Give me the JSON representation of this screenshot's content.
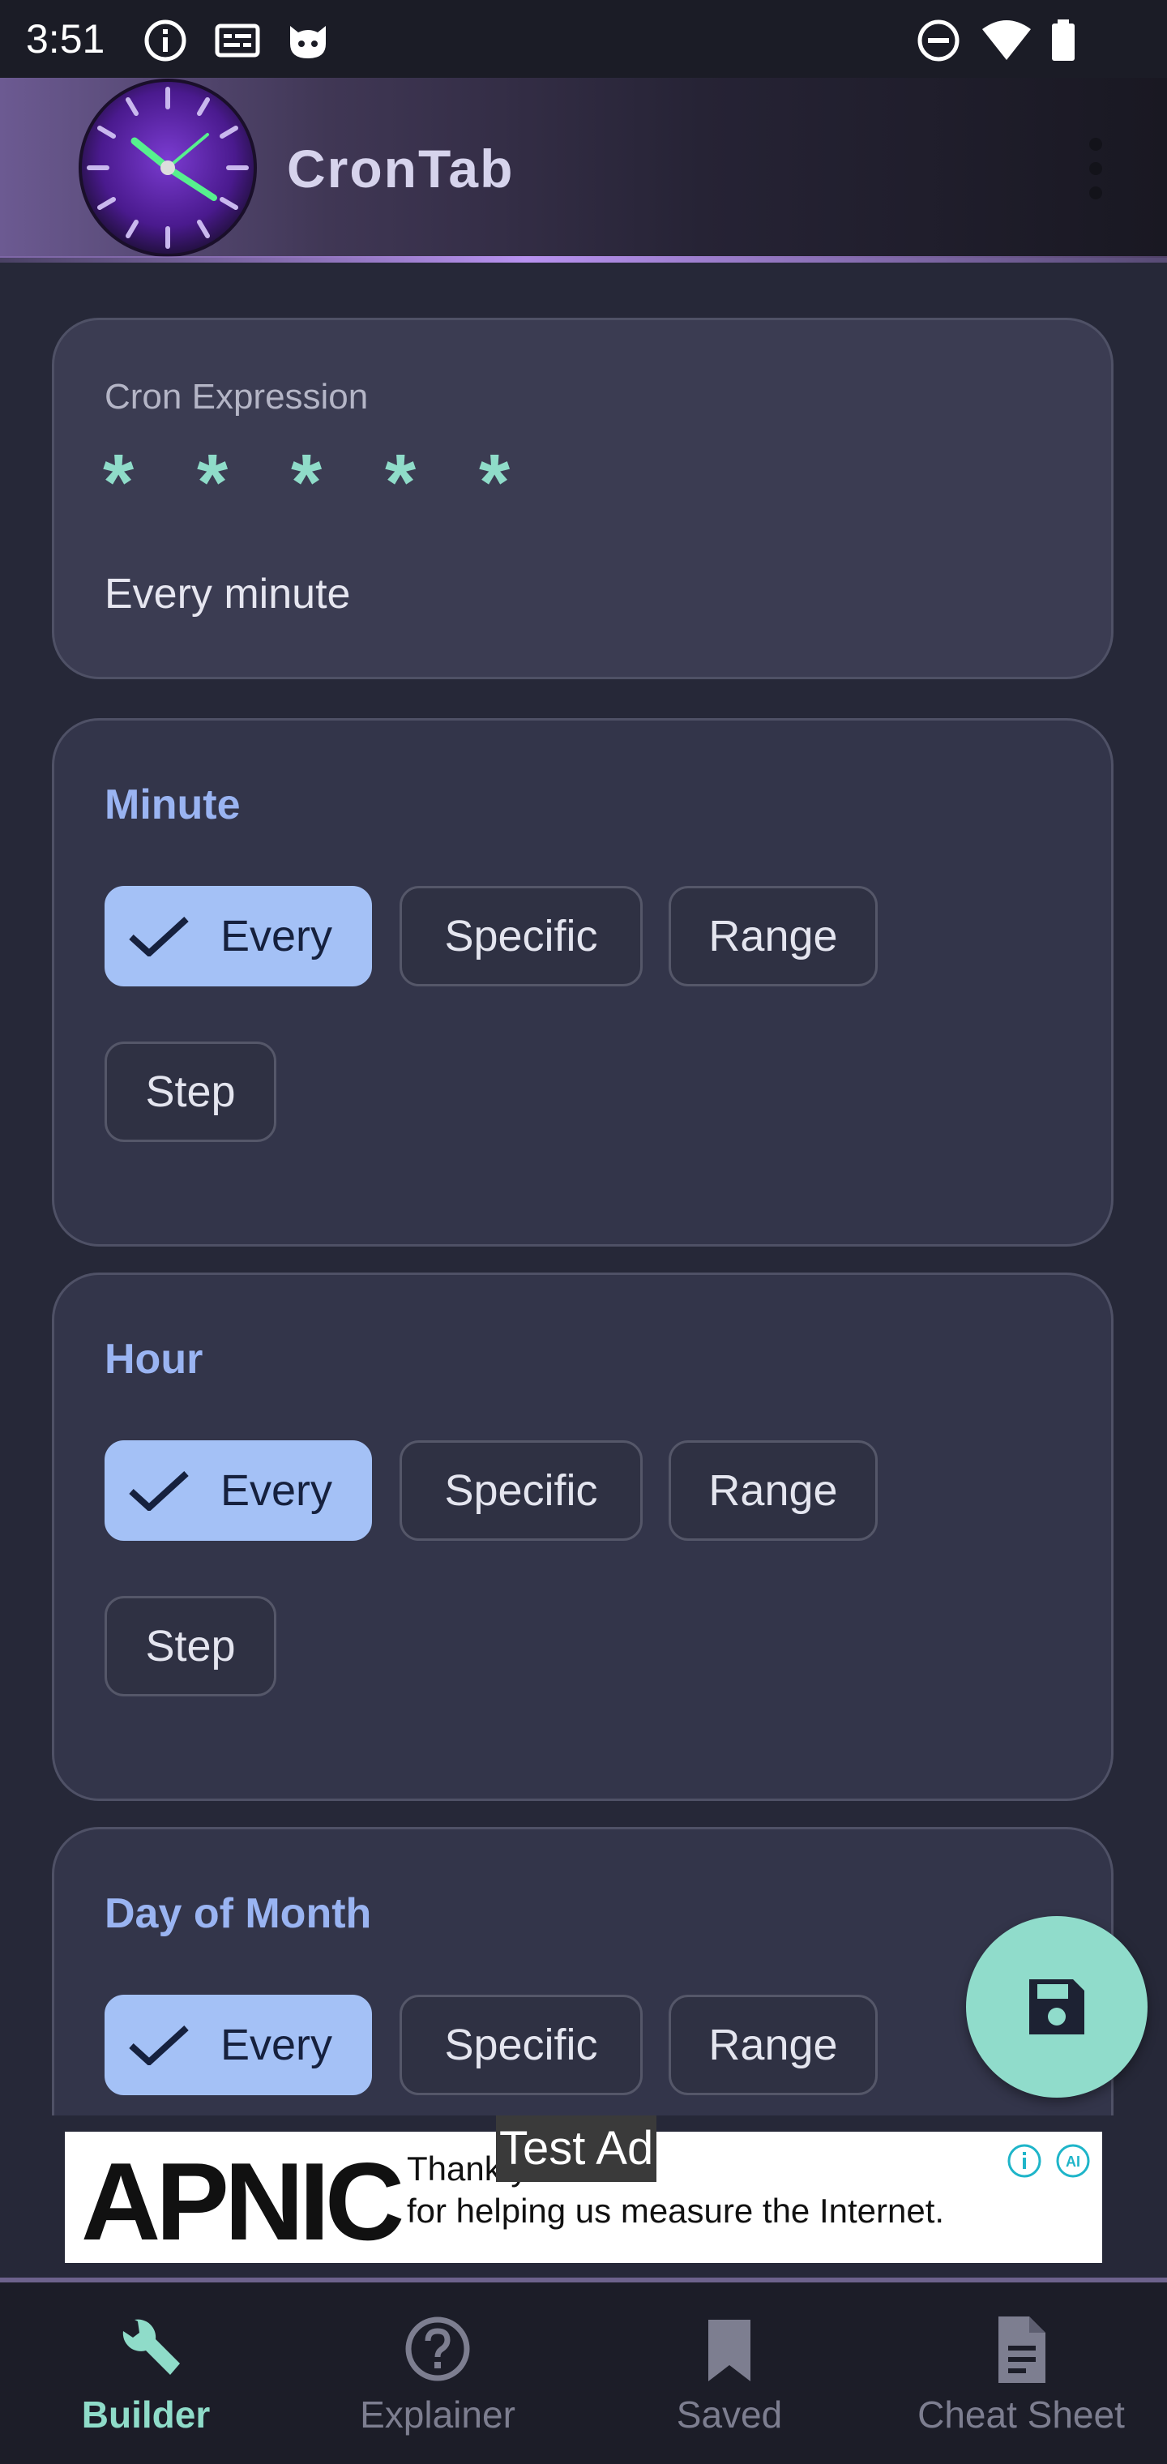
{
  "status_bar": {
    "time": "3:51",
    "left_icons": [
      "info-icon",
      "subtitles-icon",
      "cat-face-icon"
    ],
    "right_icons": [
      "do-not-disturb-icon",
      "wifi-icon",
      "battery-icon"
    ]
  },
  "app_bar": {
    "title": "CronTab",
    "logo_icon": "clock-logo-icon",
    "menu_icon": "more-vert-icon"
  },
  "expression": {
    "label": "Cron Expression",
    "fields": [
      "*",
      "*",
      "*",
      "*",
      "*"
    ],
    "description": "Every minute"
  },
  "sections": [
    {
      "title": "Minute",
      "options": [
        "Every",
        "Specific",
        "Range",
        "Step"
      ],
      "selected": "Every"
    },
    {
      "title": "Hour",
      "options": [
        "Every",
        "Specific",
        "Range",
        "Step"
      ],
      "selected": "Every"
    },
    {
      "title": "Day of Month",
      "options": [
        "Every",
        "Specific",
        "Range"
      ],
      "selected": "Every"
    }
  ],
  "fab": {
    "icon": "save-icon"
  },
  "ad": {
    "label": "Test Ad",
    "logo": "APNIC",
    "line1": "Thank you",
    "line2": "for helping us measure the Internet.",
    "icons": [
      "info-icon",
      "ai-icon"
    ]
  },
  "bottom_nav": [
    {
      "label": "Builder",
      "icon": "wrench-icon",
      "active": true
    },
    {
      "label": "Explainer",
      "icon": "help-icon",
      "active": false
    },
    {
      "label": "Saved",
      "icon": "bookmark-icon",
      "active": false
    },
    {
      "label": "Cheat Sheet",
      "icon": "document-icon",
      "active": false
    }
  ],
  "colors": {
    "background": "#262838",
    "card": "#33354a",
    "accent_teal": "#8fdcc9",
    "section_title": "#9ab4f2",
    "chip_selected": "#a4c1f6"
  }
}
